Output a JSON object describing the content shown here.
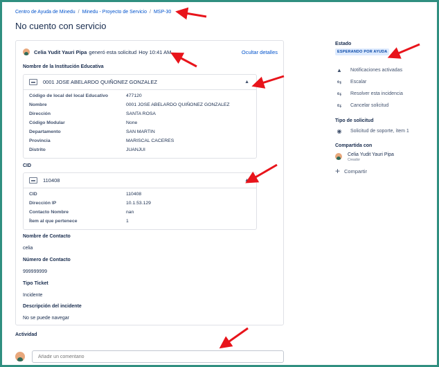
{
  "breadcrumb": {
    "items": [
      "Centro de Ayuda de Minedu",
      "Minedu - Proyecto de Servicio",
      "MSP-30"
    ],
    "separator": "/"
  },
  "page": {
    "title": "No cuento con servicio"
  },
  "request": {
    "author": "Celia Yudit Yauri Pipa",
    "action_text": "generó esta solicitud",
    "time": "Hoy 10:41 AM",
    "hide_details": "Ocultar detalles"
  },
  "institution": {
    "section_label": "Nombre de la Institución Educativa",
    "header": "0001 JOSE ABELARDO QUIÑONEZ GONZALEZ",
    "fields": [
      {
        "key": "Código de local del local Educativo",
        "value": "477120"
      },
      {
        "key": "Nombre",
        "value": "0001 JOSE ABELARDO QUIÑONEZ GONZALEZ"
      },
      {
        "key": "Dirección",
        "value": "SANTA ROSA"
      },
      {
        "key": "Código Modular",
        "value": "None"
      },
      {
        "key": "Departamento",
        "value": "SAN MARTIN"
      },
      {
        "key": "Provincia",
        "value": "MARISCAL CACERES"
      },
      {
        "key": "Distrito",
        "value": "JUANJUI"
      }
    ]
  },
  "cid": {
    "section_label": "CID",
    "header": "110408",
    "fields": [
      {
        "key": "CID",
        "value": "110408"
      },
      {
        "key": "Dirección IP",
        "value": "10.1.53.129"
      },
      {
        "key": "Contacto Nombre",
        "value": "nan"
      },
      {
        "key": "Ítem al que pertenece",
        "value": "1"
      }
    ]
  },
  "details": [
    {
      "label": "Nombre de Contacto",
      "value": "celia"
    },
    {
      "label": "Número de Contacto",
      "value": "999999999"
    },
    {
      "label": "Tipo Ticket",
      "value": "Incidente"
    },
    {
      "label": "Descripción del incidente",
      "value": "No se puede navegar"
    }
  ],
  "sidebar": {
    "status_label": "Estado",
    "status_value": "ESPERANDO POR AYUDA",
    "actions": [
      {
        "label": "Notificaciones activadas",
        "icon": "megaphone-icon"
      },
      {
        "label": "Escalar",
        "icon": "transition-icon"
      },
      {
        "label": "Resolver esta incidencia",
        "icon": "transition-icon"
      },
      {
        "label": "Cancelar solicitud",
        "icon": "transition-icon"
      }
    ],
    "request_type_label": "Tipo de solicitud",
    "request_type_value": "Solicitud de soporte, ítem 1",
    "shared_label": "Compartida con",
    "shared_person": "Celia Yudit Yauri Pipa",
    "shared_role": "Creador",
    "share_button": "Compartir"
  },
  "activity": {
    "label": "Actividad",
    "comment_placeholder": "Añadir un comentario"
  },
  "colors": {
    "link": "#0052cc",
    "badge_bg": "#deebff",
    "annotation_red": "#e8141b",
    "frame": "#2f8f80"
  }
}
